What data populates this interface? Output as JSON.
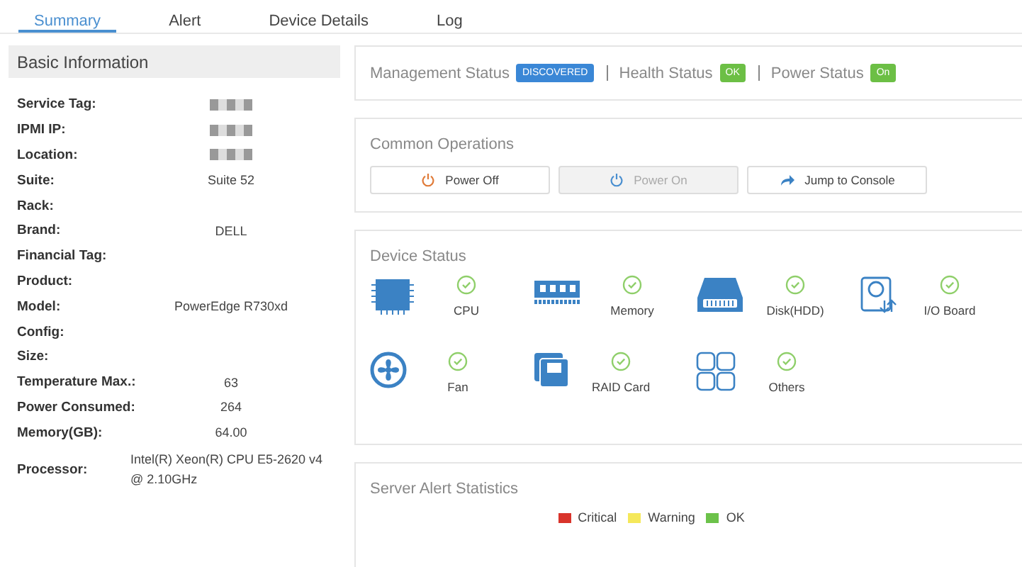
{
  "tabs": [
    {
      "label": "Summary",
      "selected": true
    },
    {
      "label": "Alert",
      "selected": false
    },
    {
      "label": "Device Details",
      "selected": false
    },
    {
      "label": "Log",
      "selected": false
    }
  ],
  "basic_information": {
    "title": "Basic Information",
    "rows": [
      {
        "label": "Service Tag:",
        "redacted": true
      },
      {
        "label": "IPMI IP:",
        "redacted": true
      },
      {
        "label": "Location:",
        "redacted": true
      },
      {
        "label": "Suite:",
        "value": "Suite 52"
      },
      {
        "label": "Rack:"
      },
      {
        "label": "Brand:",
        "value": "DELL"
      },
      {
        "label": "Financial Tag:"
      },
      {
        "label": "Product:"
      },
      {
        "label": "Model:",
        "value": "PowerEdge R730xd"
      },
      {
        "label": "Config:"
      },
      {
        "label": "Size:"
      },
      {
        "label": "Temperature Max.:",
        "value": "63"
      },
      {
        "label": "Power Consumed:",
        "value": "264"
      },
      {
        "label": "Memory(GB):",
        "value": "64.00"
      },
      {
        "label": "Processor:",
        "value": "Intel(R) Xeon(R) CPU E5-2620 v4 @ 2.10GHz"
      }
    ]
  },
  "statuses": [
    {
      "label": "Management Status",
      "badge": "DISCOVERED",
      "color": "#3a87d6"
    },
    {
      "label": "Health Status",
      "badge": "OK",
      "color": "#6cbf45"
    },
    {
      "label": "Power Status",
      "badge": "On",
      "color": "#6cbf45"
    }
  ],
  "common_operations": {
    "title": "Common Operations",
    "buttons": [
      {
        "label": "Power Off",
        "kind": "power",
        "disabled": false
      },
      {
        "label": "Power On",
        "kind": "power",
        "disabled": true
      },
      {
        "label": "Jump to Console",
        "kind": "jump",
        "disabled": false
      }
    ]
  },
  "device_status": {
    "title": "Device Status",
    "items": [
      {
        "label": "CPU",
        "kind": "cpu",
        "ok": true
      },
      {
        "label": "Memory",
        "kind": "memory",
        "ok": true
      },
      {
        "label": "Disk(HDD)",
        "kind": "disk",
        "ok": true
      },
      {
        "label": "I/O Board",
        "kind": "io",
        "ok": true
      },
      {
        "label": "Fan",
        "kind": "fan",
        "ok": true
      },
      {
        "label": "RAID Card",
        "kind": "raid",
        "ok": true
      },
      {
        "label": "Others",
        "kind": "others",
        "ok": true
      }
    ]
  },
  "alert_statistics": {
    "title": "Server Alert Statistics",
    "legend": [
      {
        "label": "Critical",
        "color": "#d9342b"
      },
      {
        "label": "Warning",
        "color": "#f5e85a"
      },
      {
        "label": "OK",
        "color": "#6cc24a"
      }
    ]
  }
}
